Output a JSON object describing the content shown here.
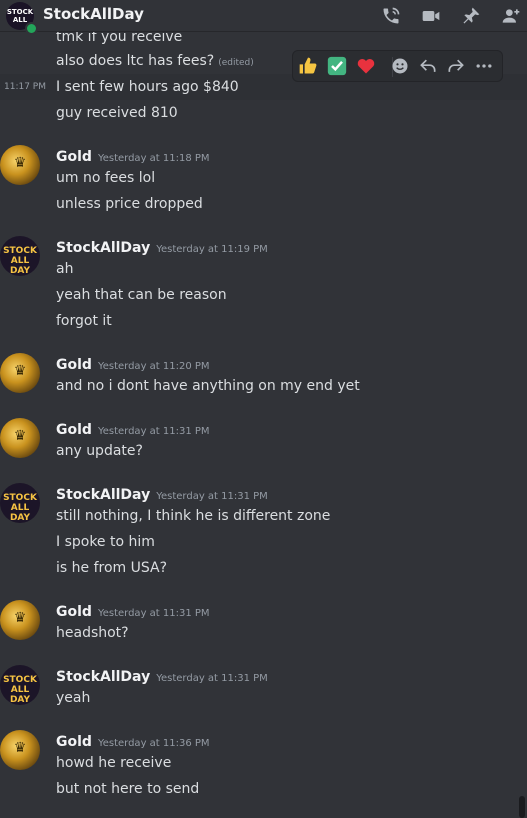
{
  "header": {
    "channel_name": "StockAllDay",
    "avatar_text_1": "STOCK",
    "avatar_text_2": "ALL",
    "icons": [
      "phone-call-icon",
      "video-call-icon",
      "pin-icon",
      "add-friend-icon"
    ]
  },
  "toolbar": {
    "reactions": [
      "thumbs-up",
      "check-mark",
      "heart"
    ],
    "icons": [
      "add-reaction-icon",
      "reply-icon",
      "forward-icon",
      "more-options-icon"
    ]
  },
  "avatars": {
    "stock_line1": "STOCK",
    "stock_line2": "ALL DAY"
  },
  "messages": {
    "top1": "tmk if you receive",
    "top2": "also does ltc has fees?",
    "top2_edited": "(edited)",
    "top3_time": "11:17 PM",
    "top3": "I sent few hours ago $840",
    "top4": "guy received 810",
    "g1_author": "Gold",
    "g1_time": "Yesterday at 11:18 PM",
    "g1_l1": "um no fees lol",
    "g1_l2": "unless price dropped",
    "s1_author": "StockAllDay",
    "s1_time": "Yesterday at 11:19 PM",
    "s1_l1": "ah",
    "s1_l2": "yeah that can be reason",
    "s1_l3": "forgot it",
    "g2_author": "Gold",
    "g2_time": "Yesterday at 11:20 PM",
    "g2_l1": "and no i dont have anything on my end yet",
    "g3_author": "Gold",
    "g3_time": "Yesterday at 11:31 PM",
    "g3_l1": "any update?",
    "s2_author": "StockAllDay",
    "s2_time": "Yesterday at 11:31 PM",
    "s2_l1": "still nothing, I think he is different zone",
    "s2_l2": "I spoke to him",
    "s2_l3": "is he from USA?",
    "g4_author": "Gold",
    "g4_time": "Yesterday at 11:31 PM",
    "g4_l1": "headshot?",
    "s3_author": "StockAllDay",
    "s3_time": "Yesterday at 11:31 PM",
    "s3_l1": "yeah",
    "g5_author": "Gold",
    "g5_time": "Yesterday at 11:36 PM",
    "g5_l1": "howd he receive",
    "g5_l2": "but not here to send"
  }
}
